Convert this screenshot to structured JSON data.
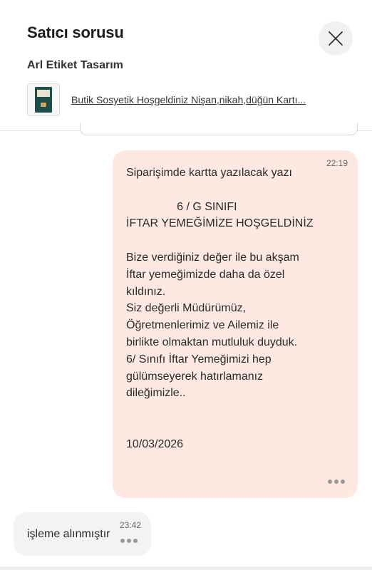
{
  "header": {
    "title": "Satıcı sorusu",
    "seller_name": "Arl Etiket Tasarım",
    "product_title": "Butik Sosyetik Hoşgeldiniz Nişan,nikah,düğün Kartı...",
    "close_icon": "close-icon"
  },
  "messages": [
    {
      "direction": "outgoing",
      "time": "22:19",
      "text": "Siparişimde kartta yazılacak yazı\n\n                6 / G SINIFI\nİFTAR YEMEĞİMİZE HOŞGELDİNİZ\n\nBize verdiğiniz değer ile bu akşam\nİftar yemeğimizde daha da özel\nkıldınız.\nSiz değerli Müdürümüz,\nÖğretmenlerimiz ve Ailemiz ile\nbirlikte olmaktan mutluluk duyduk.\n6/ Sınıfı İftar Yemeğimizi hep\ngülümseyerek hatırlamanız\ndileğimizle..\n\n\n10/03/2026\n",
      "menu_icon": "more-dots-icon"
    },
    {
      "direction": "incoming",
      "time": "23:42",
      "text": "işleme alınmıştır",
      "menu_icon": "more-dots-icon"
    }
  ],
  "colors": {
    "outgoing_bubble": "#fde9e1",
    "incoming_bubble": "#f3f3f3",
    "close_button_bg": "#f1f1f1"
  }
}
